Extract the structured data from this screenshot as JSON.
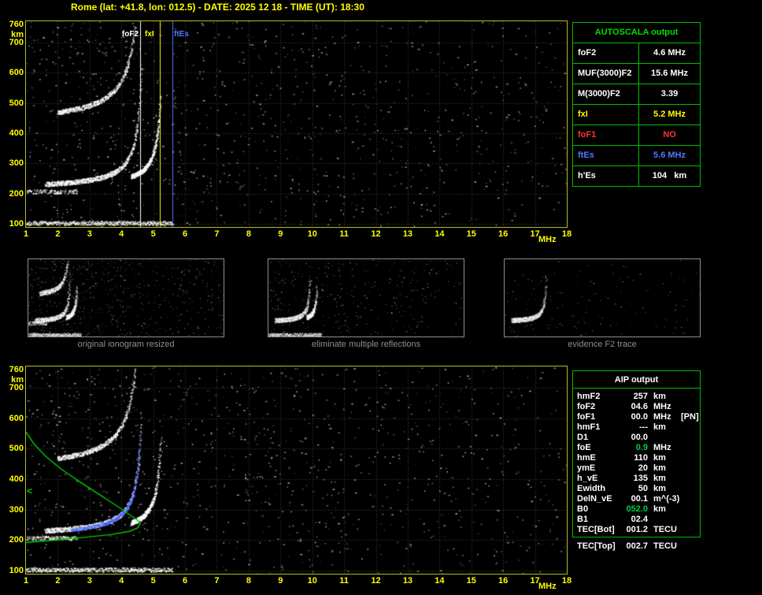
{
  "title": "Rome (lat: +41.8, lon: 012.5) - DATE: 2025 12 18 - TIME (UT): 18:30",
  "colors": {
    "background": "#000000",
    "axis_text": "#ffff00",
    "plot_border": "#b9b92a",
    "table_border": "#00bb00",
    "echo_dots": "#ffffff",
    "profile_green": "#00cc00",
    "trace_blue": "#4466ff",
    "warning_red": "#ff3333",
    "caption_gray": "#8f8f8f"
  },
  "autoscala_table": {
    "title": "AUTOSCALA output",
    "rows": [
      {
        "label": "foF2",
        "value": "4.6 MHz",
        "color": "#ffffff"
      },
      {
        "label": "MUF(3000)F2",
        "value": "15.6 MHz",
        "color": "#ffffff"
      },
      {
        "label": "M(3000)F2",
        "value": "3.39",
        "color": "#ffffff"
      },
      {
        "label": "fxI",
        "value": "5.2 MHz",
        "color": "#ffff00"
      },
      {
        "label": "foF1",
        "value": "NO",
        "color": "#ff3333"
      },
      {
        "label": "ftEs",
        "value": "5.6 MHz",
        "color": "#5577ff"
      },
      {
        "label": "h'Es",
        "value": "104   km",
        "color": "#ffffff"
      }
    ]
  },
  "aip_table": {
    "title": "AIP output",
    "rows": [
      {
        "label": "hmF2",
        "value": "257",
        "unit": "km",
        "extra": "",
        "value_color": ""
      },
      {
        "label": "foF2",
        "value": "04.6",
        "unit": "MHz",
        "extra": "",
        "value_color": ""
      },
      {
        "label": "foF1",
        "value": "00.0",
        "unit": "MHz",
        "extra": "[PN]",
        "value_color": ""
      },
      {
        "label": "hmF1",
        "value": "---",
        "unit": "km",
        "extra": "",
        "value_color": ""
      },
      {
        "label": "D1",
        "value": "00.0",
        "unit": "",
        "extra": "",
        "value_color": ""
      },
      {
        "label": "foE",
        "value": "0.9",
        "unit": "MHz",
        "extra": "",
        "value_color": "#00cc44"
      },
      {
        "label": "hmE",
        "value": "110",
        "unit": "km",
        "extra": "",
        "value_color": ""
      },
      {
        "label": "ymE",
        "value": "20",
        "unit": "km",
        "extra": "",
        "value_color": ""
      },
      {
        "label": "h_vE",
        "value": "135",
        "unit": "km",
        "extra": "",
        "value_color": ""
      },
      {
        "label": "Ewidth",
        "value": "50",
        "unit": "km",
        "extra": "",
        "value_color": ""
      },
      {
        "label": "DelN_vE",
        "value": "00.1",
        "unit": "m^(-3)",
        "extra": "",
        "value_color": ""
      },
      {
        "label": "B0",
        "value": "052.0",
        "unit": "km",
        "extra": "",
        "value_color": "#00cc44"
      },
      {
        "label": "B1",
        "value": "02.4",
        "unit": "",
        "extra": "",
        "value_color": ""
      },
      {
        "label": "TEC[Bot]",
        "value": "001.2",
        "unit": "TECU",
        "extra": "",
        "value_color": ""
      },
      {
        "label": "TEC[Top]",
        "value": "002.7",
        "unit": "TECU",
        "extra": "",
        "value_color": "",
        "outside": true
      }
    ]
  },
  "thumbnails": [
    {
      "caption": "original ionogram resized"
    },
    {
      "caption": "eliminate multiple reflections"
    },
    {
      "caption": "evidence F2 trace"
    }
  ],
  "chart_data": [
    {
      "name": "scaled_ionogram",
      "type": "scatter",
      "title": "",
      "xlabel": "MHz",
      "ylabel": "km",
      "xlim": [
        1,
        18
      ],
      "ylim": [
        90,
        770
      ],
      "x_ticks": [
        1,
        2,
        3,
        4,
        5,
        6,
        7,
        8,
        9,
        10,
        11,
        12,
        13,
        14,
        15,
        16,
        17,
        18
      ],
      "y_ticks": [
        760,
        700,
        600,
        500,
        400,
        300,
        200,
        100
      ],
      "grid": true,
      "legend": "none",
      "frequency_markers": [
        {
          "name": "foF2",
          "mhz": 4.6,
          "color": "#ffffff",
          "label": "foF2"
        },
        {
          "name": "fxI",
          "mhz": 5.2,
          "color": "#ffff00",
          "label": "fxI"
        },
        {
          "name": "ftEs",
          "mhz": 5.6,
          "color": "#5577ff",
          "label": "ftEs"
        }
      ],
      "traces": [
        {
          "name": "Es-layer",
          "kind": "flat",
          "height_km": 104,
          "f_start": 1.0,
          "f_end": 5.6,
          "weight": 1
        },
        {
          "name": "Es-multiple",
          "kind": "flat",
          "height_km": 208,
          "f_start": 1.0,
          "f_end": 2.6,
          "weight": 0.7
        },
        {
          "name": "F2-trace",
          "kind": "cusp",
          "fc": 4.75,
          "base_km": 215,
          "k": 55,
          "f_start": 1.6,
          "f_end": 4.62,
          "weight": 1
        },
        {
          "name": "F2-xmode",
          "kind": "cusp",
          "fc": 5.35,
          "base_km": 220,
          "k": 40,
          "f_start": 4.3,
          "f_end": 5.22,
          "weight": 0.6
        },
        {
          "name": "F2-multiple",
          "kind": "cusp",
          "fc": 4.75,
          "base_km": 430,
          "k": 110,
          "f_start": 2.0,
          "f_end": 4.5,
          "weight": 0.75
        }
      ]
    },
    {
      "name": "profile_ionogram",
      "type": "scatter",
      "title": "",
      "xlabel": "MHz",
      "ylabel": "km",
      "xlim": [
        1,
        18
      ],
      "ylim": [
        90,
        770
      ],
      "x_ticks": [
        1,
        2,
        3,
        4,
        5,
        6,
        7,
        8,
        9,
        10,
        11,
        12,
        13,
        14,
        15,
        16,
        17,
        18
      ],
      "y_ticks": [
        760,
        700,
        600,
        500,
        400,
        300,
        200,
        100
      ],
      "grid": true,
      "legend": "none",
      "traces": [
        {
          "name": "Es-layer",
          "kind": "flat",
          "height_km": 104,
          "f_start": 1.0,
          "f_end": 5.6,
          "weight": 1
        },
        {
          "name": "Es-multiple",
          "kind": "flat",
          "height_km": 208,
          "f_start": 1.0,
          "f_end": 2.6,
          "weight": 0.7
        },
        {
          "name": "F2-trace",
          "kind": "cusp",
          "fc": 4.75,
          "base_km": 215,
          "k": 55,
          "f_start": 1.6,
          "f_end": 4.62,
          "weight": 1
        },
        {
          "name": "F2-xmode",
          "kind": "cusp",
          "fc": 5.35,
          "base_km": 220,
          "k": 40,
          "f_start": 4.3,
          "f_end": 5.22,
          "weight": 0.6
        },
        {
          "name": "F2-multiple",
          "kind": "cusp",
          "fc": 4.75,
          "base_km": 430,
          "k": 110,
          "f_start": 2.0,
          "f_end": 4.5,
          "weight": 0.75
        }
      ],
      "profile": {
        "color": "#00cc00",
        "points_mhz_km": [
          [
            1.0,
            555
          ],
          [
            1.25,
            516
          ],
          [
            1.6,
            477
          ],
          [
            2.1,
            434
          ],
          [
            2.7,
            391
          ],
          [
            3.3,
            350
          ],
          [
            3.85,
            313
          ],
          [
            4.25,
            284
          ],
          [
            4.5,
            266
          ],
          [
            4.6,
            257
          ],
          [
            4.52,
            241
          ],
          [
            4.25,
            229
          ],
          [
            3.7,
            219
          ],
          [
            2.9,
            210
          ],
          [
            2.1,
            202
          ],
          [
            1.4,
            196
          ],
          [
            1.0,
            192
          ]
        ]
      },
      "autoscaled_trace": {
        "color": "#4466ff",
        "f_start": 2.4,
        "f_end": 4.6
      },
      "marker_left": {
        "symbol": "<",
        "height_km": 367,
        "color": "#00cc00"
      }
    }
  ]
}
